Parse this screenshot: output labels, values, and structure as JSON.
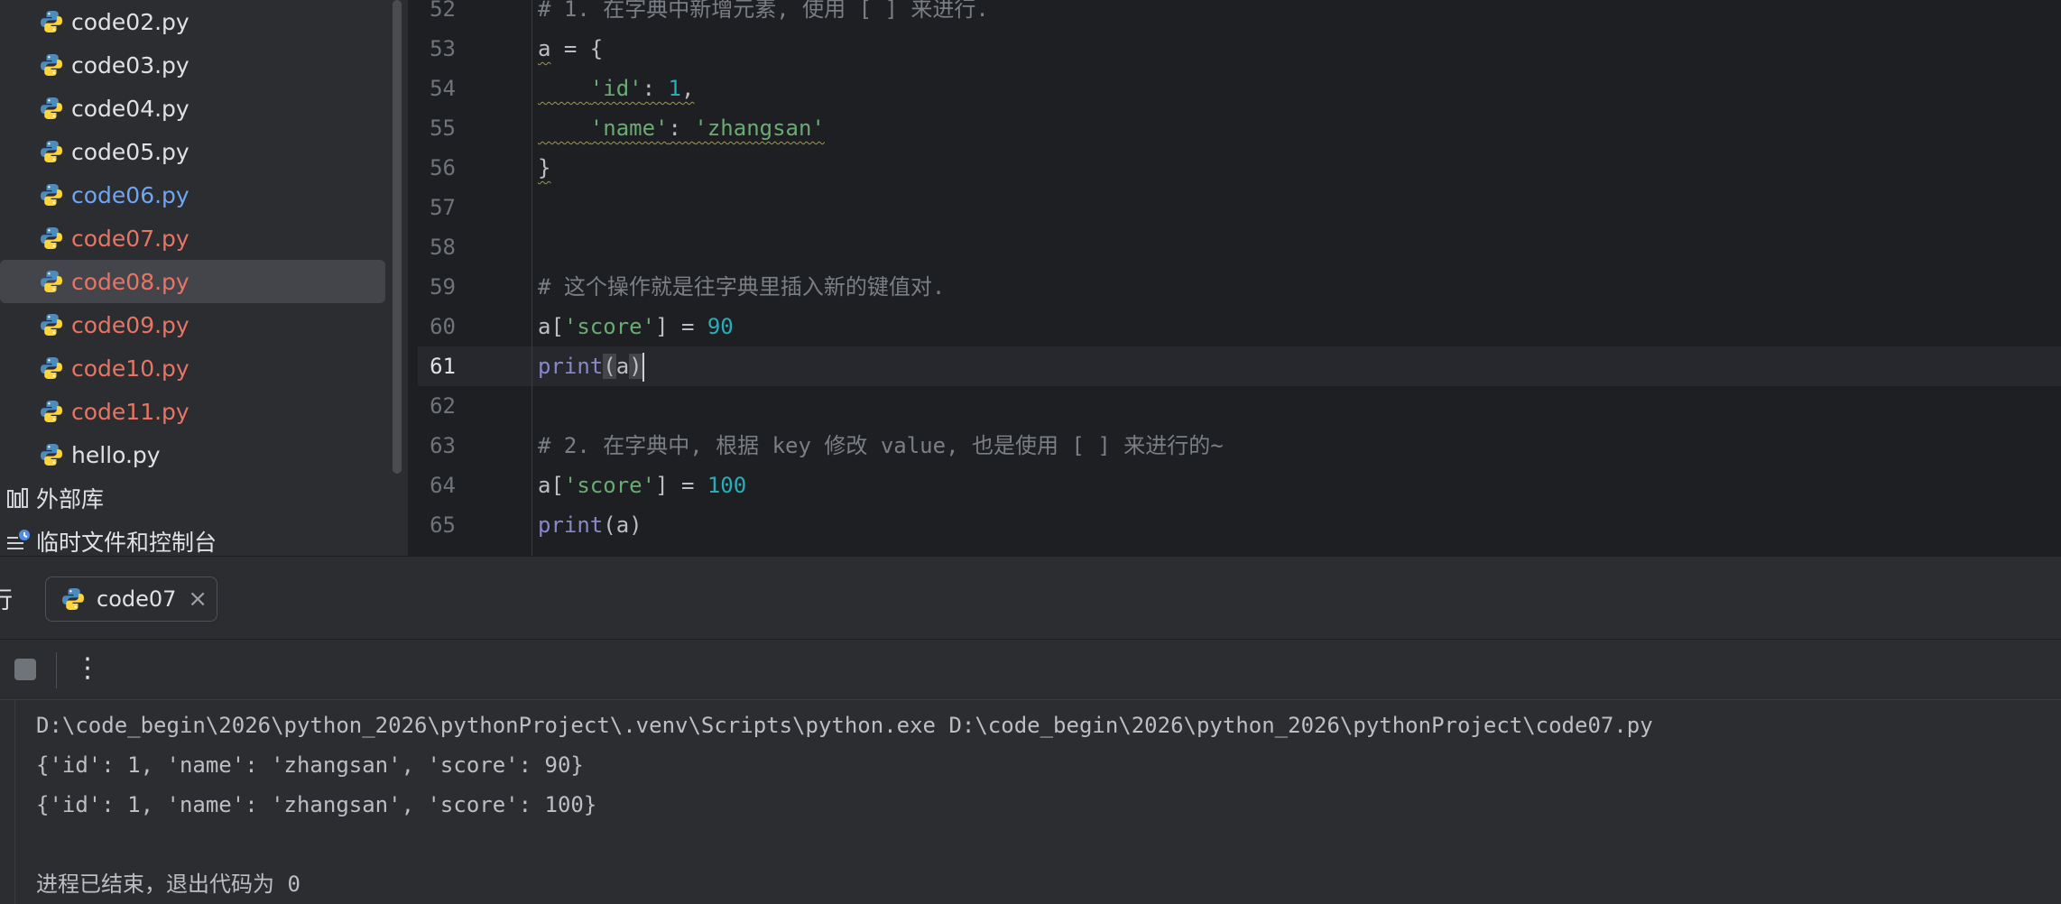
{
  "project_tree": {
    "files": [
      {
        "name": "code02.py",
        "color": "#dfe1e5"
      },
      {
        "name": "code03.py",
        "color": "#dfe1e5"
      },
      {
        "name": "code04.py",
        "color": "#dfe1e5"
      },
      {
        "name": "code05.py",
        "color": "#dfe1e5"
      },
      {
        "name": "code06.py",
        "color": "#6ea5f4"
      },
      {
        "name": "code07.py",
        "color": "#e87563"
      },
      {
        "name": "code08.py",
        "color": "#e87563",
        "selected": true
      },
      {
        "name": "code09.py",
        "color": "#e87563"
      },
      {
        "name": "code10.py",
        "color": "#e87563"
      },
      {
        "name": "code11.py",
        "color": "#e87563"
      },
      {
        "name": "hello.py",
        "color": "#dfe1e5"
      }
    ],
    "external_libraries": "外部库",
    "scratches": "临时文件和控制台"
  },
  "editor": {
    "current_line": "61",
    "lines": [
      {
        "num": "52",
        "tokens": [
          {
            "t": "cmt",
            "v": "# 1. 在字典中新增元素, 使用 [ ] 来进行."
          }
        ]
      },
      {
        "num": "53",
        "tokens": [
          {
            "t": "var",
            "v": "a",
            "squig": true
          },
          {
            "t": "op",
            "v": " = {"
          }
        ]
      },
      {
        "num": "54",
        "tokens": [
          {
            "t": "op",
            "v": "    ",
            "squig": true
          },
          {
            "t": "str",
            "v": "'id'",
            "squig": true
          },
          {
            "t": "op",
            "v": ": ",
            "squig": true
          },
          {
            "t": "num",
            "v": "1",
            "squig": true
          },
          {
            "t": "op",
            "v": ",",
            "squig": true
          }
        ]
      },
      {
        "num": "55",
        "tokens": [
          {
            "t": "op",
            "v": "    ",
            "squig": true
          },
          {
            "t": "str",
            "v": "'name'",
            "squig": true
          },
          {
            "t": "op",
            "v": ": ",
            "squig": true
          },
          {
            "t": "str",
            "v": "'zhangsan'",
            "squig": true
          }
        ]
      },
      {
        "num": "56",
        "tokens": [
          {
            "t": "op",
            "v": "}",
            "squig": true
          }
        ]
      },
      {
        "num": "57",
        "tokens": []
      },
      {
        "num": "58",
        "tokens": []
      },
      {
        "num": "59",
        "tokens": [
          {
            "t": "cmt",
            "v": "# 这个操作就是往字典里插入新的键值对."
          }
        ]
      },
      {
        "num": "60",
        "tokens": [
          {
            "t": "var",
            "v": "a["
          },
          {
            "t": "str",
            "v": "'score'"
          },
          {
            "t": "var",
            "v": "] = "
          },
          {
            "t": "num",
            "v": "90"
          }
        ]
      },
      {
        "num": "61",
        "tokens": [
          {
            "t": "fn",
            "v": "print"
          },
          {
            "t": "par",
            "v": "(",
            "match": true
          },
          {
            "t": "var",
            "v": "a"
          },
          {
            "t": "par",
            "v": ")",
            "match": true
          }
        ],
        "caret": true
      },
      {
        "num": "62",
        "tokens": []
      },
      {
        "num": "63",
        "tokens": [
          {
            "t": "cmt",
            "v": "# 2. 在字典中, 根据 key 修改 value, 也是使用 [ ] 来进行的~"
          }
        ]
      },
      {
        "num": "64",
        "tokens": [
          {
            "t": "var",
            "v": "a["
          },
          {
            "t": "str",
            "v": "'score'"
          },
          {
            "t": "var",
            "v": "] = "
          },
          {
            "t": "num",
            "v": "100"
          }
        ]
      },
      {
        "num": "65",
        "tokens": [
          {
            "t": "fn",
            "v": "print"
          },
          {
            "t": "par",
            "v": "("
          },
          {
            "t": "var",
            "v": "a"
          },
          {
            "t": "par",
            "v": ")"
          }
        ]
      }
    ]
  },
  "run_panel": {
    "title": "行",
    "tab_label": "code07",
    "close_glyph": "×",
    "more_glyph": "⋮",
    "console": [
      "D:\\code_begin\\2026\\python_2026\\pythonProject\\.venv\\Scripts\\python.exe D:\\code_begin\\2026\\python_2026\\pythonProject\\code07.py",
      "{'id': 1, 'name': 'zhangsan', 'score': 90}",
      "{'id': 1, 'name': 'zhangsan', 'score': 100}",
      "",
      "进程已结束，退出代码为 0"
    ]
  },
  "colors": {
    "comment": "#7a7e85",
    "string": "#6aab73",
    "number": "#2aacb8",
    "builtin": "#8888c6",
    "text": "#bcbec4",
    "modified_file": "#6ea5f4",
    "error_file": "#e87563"
  },
  "icons": [
    "python-file-icon",
    "library-icon",
    "scratches-icon",
    "stop-icon",
    "more-icon",
    "close-icon"
  ]
}
